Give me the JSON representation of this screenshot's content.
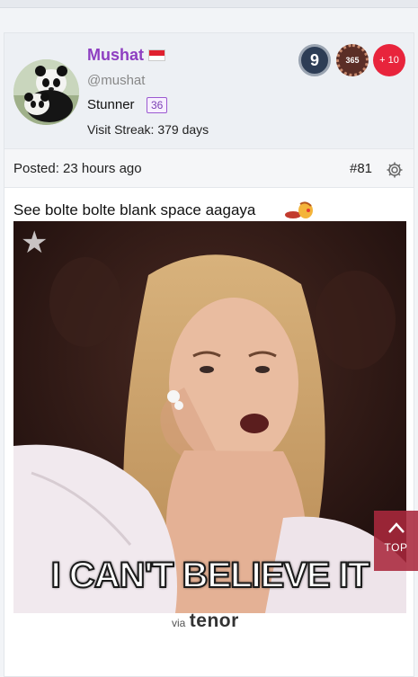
{
  "user": {
    "username": "Mushat",
    "handle": "@mushat",
    "rank": "Stunner",
    "rank_level": "36",
    "visit_streak": "Visit Streak: 379 days"
  },
  "badges": {
    "badge_1": "9",
    "badge_2": "365",
    "more": "+ 10"
  },
  "post": {
    "posted": "Posted: 23 hours ago",
    "number": "#81",
    "text": "See bolte bolte blank space aagaya",
    "gif_caption": "I CAN'T BELIEVE IT",
    "via": "via",
    "provider": "tenor"
  },
  "top_button": {
    "label": "TOP"
  },
  "colors": {
    "username": "#8e3fc1",
    "accent_red": "#e8243c",
    "top_button": "#aa283c"
  }
}
